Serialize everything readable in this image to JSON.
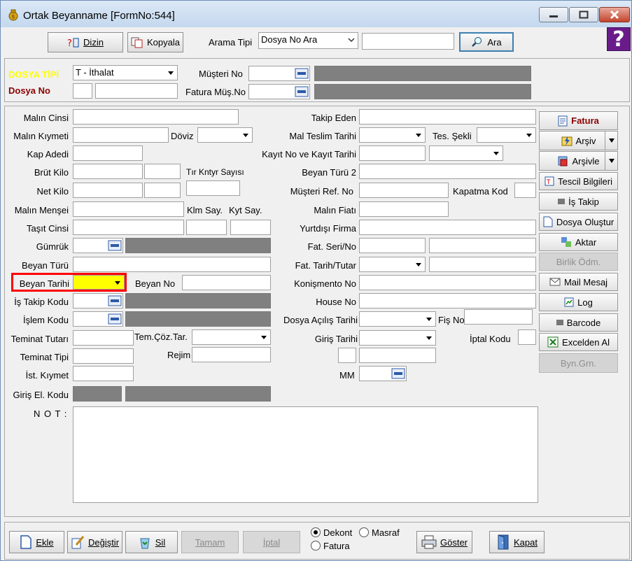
{
  "window": {
    "title": "Ortak Beyanname [FormNo:544]",
    "help_label": "?"
  },
  "toolbar": {
    "dizin_label": "Dizin",
    "kopyala_label": "Kopyala",
    "arama_tipi_label": "Arama Tipi",
    "arama_tipi_value": "Dosya No Ara",
    "search_value": "",
    "ara_label": "Ara"
  },
  "header": {
    "dosya_tipi_label": "DOSYA TİPİ",
    "dosya_tipi_value": "T - İthalat",
    "dosya_no_label": "Dosya No",
    "musteri_no_label": "Müşteri No",
    "fatura_mus_no_label": "Fatura Müş.No"
  },
  "left_fields": {
    "malin_cinsi": "Malın Cinsi",
    "malin_kiymeti": "Malın Kıymeti",
    "doviz": "Döviz",
    "kap_adedi": "Kap Adedi",
    "brut_kilo": "Brüt Kilo",
    "tir_kntyr": "Tır Kntyr Sayısı",
    "net_kilo": "Net Kilo",
    "malin_mensei": "Malın Menşei",
    "klm_say": "Klm Say.",
    "kyt_say": "Kyt Say.",
    "tasit_cinsi": "Taşıt Cinsi",
    "gumruk": "Gümrük",
    "beyan_turu": "Beyan Türü",
    "beyan_tarihi": "Beyan Tarihi",
    "beyan_no": "Beyan No",
    "is_takip_kodu": "İş Takip Kodu",
    "islem_kodu": "İşlem Kodu",
    "teminat_tutari": "Teminat Tutarı",
    "tem_coz_tar": "Tem.Çöz.Tar.",
    "teminat_tipi": "Teminat Tipi",
    "rejim": "Rejim",
    "ist_kiymet": "İst. Kıymet",
    "giris_el_kodu": "Giriş El. Kodu",
    "not": "N O T :"
  },
  "right_fields": {
    "takip_eden": "Takip Eden",
    "mal_teslim_tarihi": "Mal Teslim Tarihi",
    "tes_sekli": "Tes. Şekli",
    "kayit_no": "Kayıt  No  ve Kayıt Tarihi",
    "beyan_turu_2": "Beyan Türü 2",
    "musteri_ref_no": "Müşteri  Ref. No",
    "kapatma_kod": "Kapatma Kod",
    "malin_fiati": "Malın Fiatı",
    "yurtdisi_firma": "Yurtdışı Firma",
    "fat_seri_no": "Fat. Seri/No",
    "fat_tarih_tutar": "Fat. Tarih/Tutar",
    "konismento_no": "Konişmento No",
    "house_no": "House No",
    "dosya_acilis_tarihi": "Dosya Açılış Tarihi",
    "fis_no": "Fiş No",
    "giris_tarihi": "Giriş Tarihi",
    "iptal_kodu": "İptal Kodu",
    "mm": "MM"
  },
  "side_buttons": {
    "fatura": "Fatura",
    "arsiv": "Arşiv",
    "arsivle": "Arşivle",
    "tescil": "Tescil Bilgileri",
    "is_takip": "İş Takip",
    "dosya_olustur": "Dosya Oluştur",
    "aktar": "Aktar",
    "birlik_odm": "Birlik Ödm.",
    "mail_mesaj": "Mail Mesaj",
    "log": "Log",
    "barcode": "Barcode",
    "excelden_al": "Excelden Al",
    "byn_grn": "Byn.Grn."
  },
  "bottom": {
    "ekle": "Ekle",
    "degistir": "Değiştir",
    "sil": "Sil",
    "tamam": "Tamam",
    "iptal": "İptal",
    "dekont": "Dekont",
    "masraf": "Masraf",
    "fatura": "Fatura",
    "goster": "Göster",
    "kapat": "Kapat",
    "selected_radio": "Dekont"
  },
  "colors": {
    "dosya_tipi_label": "#ffff00",
    "dosya_no_label": "#8b0000",
    "fatura_button_text": "#8b0000",
    "highlight_border": "#ff0000",
    "beyan_tarihi_fill": "#ffff00"
  }
}
